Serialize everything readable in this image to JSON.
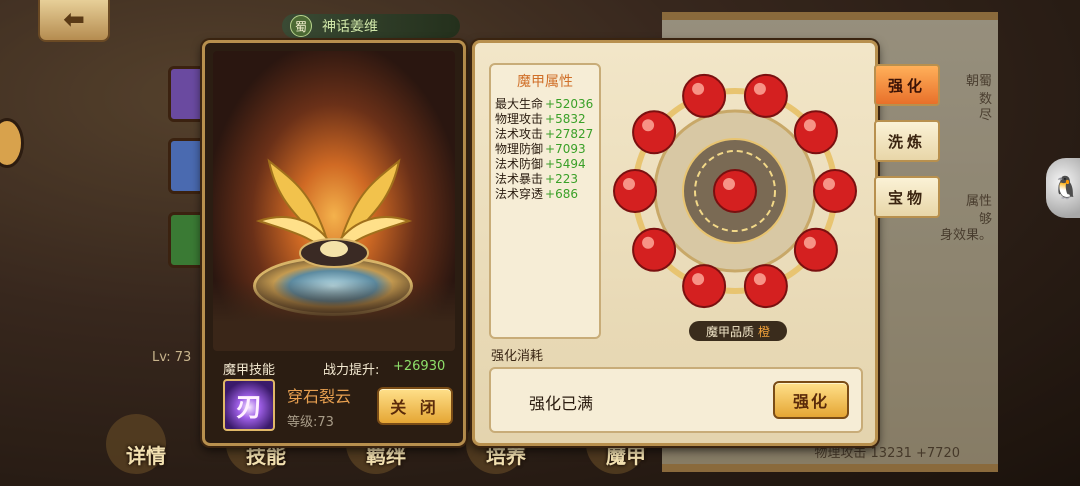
{
  "header": {
    "back_icon": "arrow-left-icon",
    "kingdom_badge": "蜀",
    "hero_title": "神话姜维"
  },
  "background": {
    "level_text": "Lv: 73",
    "scroll_lines": [
      "朝蜀",
      "数",
      "尽",
      "属性",
      "够",
      "身效果。"
    ],
    "scroll_bottom_text": "物理攻击 13231 +7720"
  },
  "bottom_nav": {
    "items": [
      {
        "label": "详情"
      },
      {
        "label": "技能"
      },
      {
        "label": "羁绊"
      },
      {
        "label": "培养"
      },
      {
        "label": "魔甲"
      }
    ]
  },
  "left_panel": {
    "skill_header": "魔甲技能",
    "power_label": "战力提升:",
    "power_value": "+26930",
    "skill_icon_glyph": "刃",
    "skill_name": "穿石裂云",
    "skill_level": "等级:73",
    "close_label": "关 闭"
  },
  "right_panel": {
    "attr_title": "魔甲属性",
    "attributes": [
      {
        "name": "最大生命",
        "value": "+52036"
      },
      {
        "name": "物理攻击",
        "value": "+5832"
      },
      {
        "name": "法术攻击",
        "value": "+27827"
      },
      {
        "name": "物理防御",
        "value": "+7093"
      },
      {
        "name": "法术防御",
        "value": "+5494"
      },
      {
        "name": "法术暴击",
        "value": "+223"
      },
      {
        "name": "法术穿透",
        "value": "+686"
      }
    ],
    "quality_label": "魔甲品质",
    "quality_value": "橙",
    "consume_label": "强化消耗",
    "consume_text": "强化已满",
    "upgrade_label": "强化",
    "gem_count": 11,
    "gem_color": "#d42020"
  },
  "side_tabs": [
    {
      "label": "强化",
      "active": true
    },
    {
      "label": "洗炼",
      "active": false
    },
    {
      "label": "宝物",
      "active": false
    }
  ],
  "colors": {
    "accent_gold": "#e5a634",
    "stat_green": "#3aa028",
    "quality_orange": "#f2a23a"
  }
}
